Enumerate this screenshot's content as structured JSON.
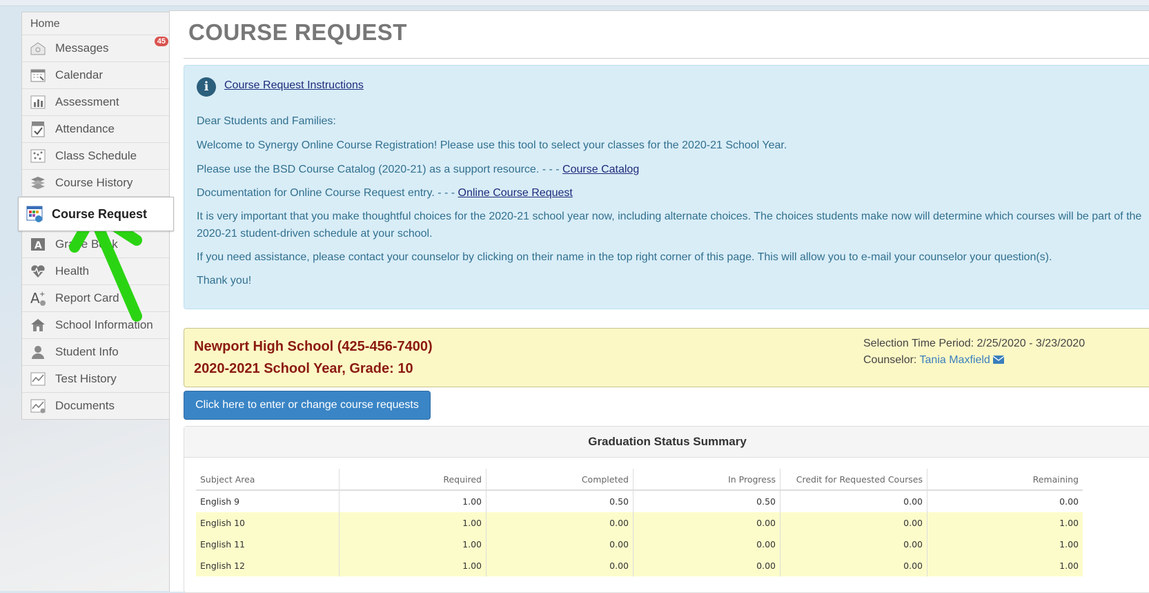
{
  "sidebar": {
    "home": "Home",
    "messages_badge": "45",
    "items": [
      {
        "label": "Messages",
        "icon": "messages-icon"
      },
      {
        "label": "Calendar",
        "icon": "calendar-icon"
      },
      {
        "label": "Assessment",
        "icon": "assessment-icon"
      },
      {
        "label": "Attendance",
        "icon": "attendance-icon"
      },
      {
        "label": "Class Schedule",
        "icon": "class-schedule-icon"
      },
      {
        "label": "Course History",
        "icon": "course-history-icon"
      },
      {
        "label": "Course Request",
        "icon": "course-request-icon",
        "active": true
      },
      {
        "label": "Grade Book",
        "icon": "grade-book-icon"
      },
      {
        "label": "Health",
        "icon": "health-icon"
      },
      {
        "label": "Report Card",
        "icon": "report-card-icon"
      },
      {
        "label": "School Information",
        "icon": "school-information-icon"
      },
      {
        "label": "Student Info",
        "icon": "student-info-icon"
      },
      {
        "label": "Test History",
        "icon": "test-history-icon"
      },
      {
        "label": "Documents",
        "icon": "documents-icon"
      }
    ]
  },
  "page": {
    "title": "COURSE REQUEST"
  },
  "info": {
    "instructions_link": "Course Request Instructions",
    "greeting": "Dear Students and Families:",
    "welcome": "Welcome to Synergy Online Course Registration! Please use this tool to select your classes for the 2020-21 School Year.",
    "catalog_text": "Please use the BSD Course Catalog (2020-21) as a support resource. - - - ",
    "catalog_link": "Course Catalog",
    "doc_text": "Documentation for Online Course Request entry. - - - ",
    "doc_link": "Online Course Request",
    "important": "It is very important that you make thoughtful choices for the 2020-21 school year now, including alternate choices. The choices students make now will determine which courses will be part of the 2020-21 student-driven schedule at your school.",
    "assist": "If you need assistance, please contact your counselor by clicking on their name in the top right corner of this page. This will allow you to e-mail your counselor your question(s).",
    "thanks": "Thank you!"
  },
  "school": {
    "name": "Newport High School (425-456-7400)",
    "year_grade": "2020-2021 School Year, Grade: 10",
    "selection_period": "Selection Time Period: 2/25/2020 - 3/23/2020",
    "counselor_label": "Counselor: ",
    "counselor_name": "Tania Maxfield"
  },
  "actions": {
    "enter_requests": "Click here to enter or change course requests"
  },
  "graduation": {
    "title": "Graduation Status Summary",
    "columns": [
      "Subject Area",
      "Required",
      "Completed",
      "In Progress",
      "Credit for Requested Courses",
      "Remaining"
    ],
    "rows": [
      [
        "English 9",
        "1.00",
        "0.50",
        "0.50",
        "0.00",
        "0.00"
      ],
      [
        "English 10",
        "1.00",
        "0.00",
        "0.00",
        "0.00",
        "1.00"
      ],
      [
        "English 11",
        "1.00",
        "0.00",
        "0.00",
        "0.00",
        "1.00"
      ],
      [
        "English 12",
        "1.00",
        "0.00",
        "0.00",
        "0.00",
        "1.00"
      ]
    ]
  },
  "colors": {
    "annotation_arrow": "#2bd412",
    "info_bg": "#d9edf7",
    "school_bg": "#fcf8c6",
    "button": "#3a85c6"
  }
}
